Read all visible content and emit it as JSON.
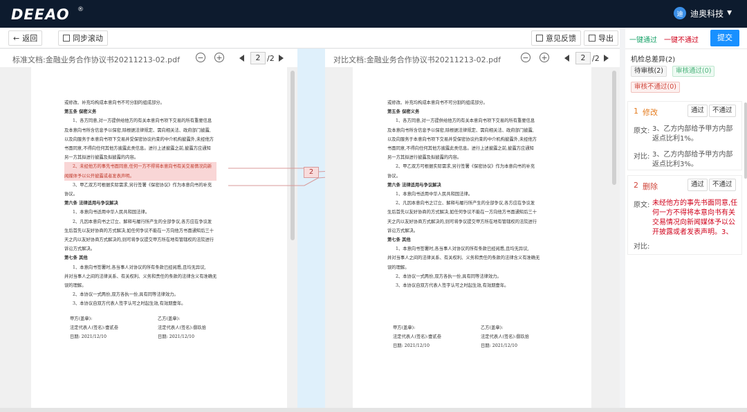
{
  "brand": {
    "logo": "DEEAO",
    "reg": "®"
  },
  "user": {
    "avatar": "迪",
    "name": "迪奥科技"
  },
  "toolbar": {
    "back": "返回",
    "sync": "同步滚动",
    "feedback": "意见反馈",
    "export": "导出"
  },
  "left_doc": {
    "label": "标准文档:",
    "file": "金融业务合作协议书20211213-02.pdf",
    "page": "2",
    "total": "/2"
  },
  "right_doc": {
    "label": "对比文档:",
    "file": "金融业务合作协议书20211213-02.pdf",
    "page": "2",
    "total": "/2"
  },
  "gutter_badge": "2",
  "doc_left": {
    "lines": [
      "或修改、补充均构成本意向书不可分割的组成部分。",
      "第五条 保密义务",
      "1、各方同意,对一方提供给他方的有关本意向书项下交易的所有重要信息",
      "及本意向书所含信息予以保密,除根据法律规定、需向相关法、政府部门披露,",
      "以及向服务于本意向书项下交易并受保密协议约束的中介机构披露外,未经他方",
      "书面同意,不得向任何其他方披露此类信息。进行上述披露之前,披露方应通知",
      "另一方其拟进行披露及拟披露的内容。",
      "2、未经他方的事先书面同意,任何一方不得将本意向书有关交易情况向新",
      "闻媒体予以公开披露或者发表声明。",
      "3、甲乙双方可根据实际需求,另行签署《保密协议》作为本意向书的补充",
      "协议。",
      "第六条 法律适用与争议解决",
      "1、本意向书适用中华人民共和国法律。",
      "2、凡因本意向书之订立、解释与履行所产生的全部争议,各方应在争议发",
      "生后首先以友好协商的方式解决,如任何争议不能在一方向他方书面通知后三十",
      "天之内以友好协商方式解决的,则可将争议提交甲方所在地有管辖权的法院进行",
      "诉讼方式解决。",
      "第七条 其他",
      "1、本意向书签署时,各当事人对协议的所有条款已经阅悉,且均无异议,",
      "并对当事人之间的法律关系、有关权利、义务和责任的条款的法律含义有准确无",
      "误的理解。",
      "2、本协议一式两份,双方各执一份,具有同等法律效力。",
      "3、本协议自双方代表人签字认可之时起生效,有效期壹年。"
    ],
    "sign": {
      "party_a": "甲方(盖章):",
      "party_b": "乙方(盖章):",
      "rep_a": "法定代表人(签名):壹贰叁",
      "rep_b": "法定代表人(签名):捌玖拾",
      "date_a": "日期: 2021/12/10",
      "date_b": "日期: 2021/12/10"
    }
  },
  "doc_right": {
    "lines": [
      "或修改、补充均构成本意向书不可分割的组成部分。",
      "第五条 保密义务",
      "1、各方同意,对一方提供给他方的有关本意向书项下交易的所有重要信息",
      "及本意向书所含信息予以保密,除根据法律规定、需向相关法、政府部门披露,",
      "以及向服务于本意向书项下交易并受保密协议约束的中介机构披露外,未经他方",
      "书面同意,不得向任何其他方披露此类信息。进行上述披露之前,披露方应通知",
      "另一方其拟进行披露及拟披露的内容。",
      "2、甲乙双方可根据实际需求,另行签署《保密协议》作为本意向书的补充",
      "协议。",
      "第六条 法律适用与争议解决",
      "1、本意向书适用中华人民共和国法律。",
      "2、凡因本意向书之订立、解释与履行所产生的全部争议,各方应在争议发",
      "生后首先以友好协商的方式解决,如任何争议不能在一方向他方书面通知后三十",
      "天之内以友好协商方式解决的,则可将争议提交甲方所在地有管辖权的法院进行",
      "诉讼方式解决。",
      "第七条 其他",
      "1、本意向书签署时,各当事人对协议的所有条款已经阅悉,且均无异议,",
      "并对当事人之间的法律关系、有关权利、义务和责任的条款的法律含义有准确无",
      "误的理解。",
      "2、本协议一式两份,双方各执一份,具有同等法律效力。",
      "3、本协议自双方代表人签字认可之时起生效,有效期壹年。"
    ],
    "sign": {
      "party_a": "甲方(盖章):",
      "party_b": "乙方(盖章):",
      "rep_a": "法定代表人(签名):壹贰叁",
      "rep_b": "法定代表人(签名):捌玖拾",
      "date_a": "日期: 2021/12/10",
      "date_b": "日期: 2021/12/10"
    }
  },
  "panel": {
    "pass_all": "一键通过",
    "reject_all": "一键不通过",
    "submit": "提交",
    "summary": "机检总差异(2)",
    "pending": "待审核(2)",
    "approved": "审核通过(0)",
    "rejected": "审核不通过(0)",
    "items": [
      {
        "num": "1",
        "kind": "修改",
        "pass": "通过",
        "reject": "不通过",
        "orig_label": "原文:",
        "orig": "3、乙方内部给予甲方内部返点比利1%。",
        "cmp_label": "对比:",
        "cmp": "3、乙方内部给予甲方内部返点比利3%。"
      },
      {
        "num": "2",
        "kind": "删除",
        "pass": "通过",
        "reject": "不通过",
        "orig_label": "原文:",
        "orig": "未经他方的事先书面同意,任何一方不得将本意向书有关交易情况向新闻媒体予以公开披露或者发表声明。3、",
        "cmp_label": "对比:",
        "cmp": ""
      }
    ]
  },
  "colors": {
    "topbar": "#0d1b2e",
    "accent": "#1890ff",
    "green": "#1aa36a",
    "red": "#d0021b",
    "orange": "#e57c1f"
  }
}
